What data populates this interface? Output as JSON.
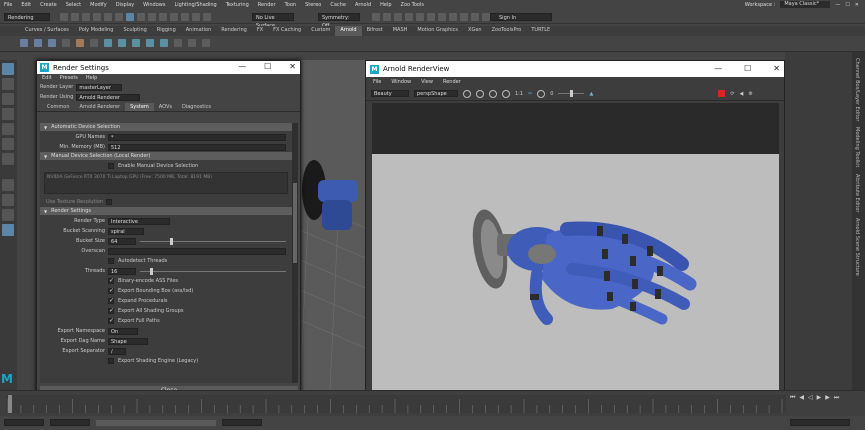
{
  "menubar": [
    "File",
    "Edit",
    "Create",
    "Select",
    "Modify",
    "Display",
    "Windows",
    "Lighting/Shading",
    "Texturing",
    "Render",
    "Toon",
    "Stereo",
    "Cache",
    "Arnold",
    "Help",
    "Zoo Tools"
  ],
  "workspace": {
    "label": "Workspace :",
    "value": "Maya Classic*"
  },
  "statusline": {
    "mode": "Rendering",
    "live_surface": "No Live Surface",
    "symmetry": "Symmetry: Off",
    "sign_in": "Sign In"
  },
  "shelf_tabs": [
    "Curves / Surfaces",
    "Poly Modeling",
    "Sculpting",
    "Rigging",
    "Animation",
    "Rendering",
    "FX",
    "FX Caching",
    "Custom",
    "Arnold",
    "Bifrost",
    "MASH",
    "Motion Graphics",
    "XGen",
    "ZooToolsPro",
    "TURTLE"
  ],
  "shelf_active": "Arnold",
  "right_vtabs": [
    "Channel Box/Layer Editor",
    "Modeling Toolkit",
    "Attribute Editor",
    "Arnold Scene Structure"
  ],
  "render_settings": {
    "title": "Render Settings",
    "menu": [
      "Edit",
      "Presets",
      "Help"
    ],
    "render_layer_label": "Render Layer",
    "render_layer_value": "masterLayer",
    "render_using_label": "Render Using",
    "render_using_value": "Arnold Renderer",
    "tabs": [
      "Common",
      "Arnold Renderer",
      "System",
      "AOVs",
      "Diagnostics"
    ],
    "active_tab": "System",
    "sections": {
      "auto_device": "Automatic Device Selection",
      "gpu_names_label": "GPU Names",
      "gpu_names_value": "*",
      "min_memory_label": "Min. Memory (MB)",
      "min_memory_value": "512",
      "manual_device": "Manual Device Selection (Local Render)",
      "enable_manual": "Enable Manual Device Selection",
      "gpu_list": "NVIDIA GeForce RTX 3070 Ti Laptop GPU (Free: 7500 MB, Total: 8191 MB)",
      "use_texture_res": "Use Texture Resolution",
      "render_settings": "Render Settings",
      "render_type_label": "Render Type",
      "render_type_value": "Interactive",
      "bucket_scanning_label": "Bucket Scanning",
      "bucket_scanning_value": "spiral",
      "bucket_size_label": "Bucket Size",
      "bucket_size_value": "64",
      "overscan_label": "Overscan",
      "autodetect_threads": "Autodetect Threads",
      "threads_label": "Threads",
      "threads_value": "16",
      "checks": [
        "Binary-encode ASS Files",
        "Export Bounding Box (ass/lsd)",
        "Expand Procedurals",
        "Export All Shading Groups",
        "Export Full Paths"
      ],
      "export_namespace_label": "Export Namespace",
      "export_namespace_value": "On",
      "export_dag_label": "Export Dag Name",
      "export_dag_value": "Shape",
      "export_sep_label": "Export Separator",
      "export_sep_value": "/",
      "export_shading": "Export Shading Engine (Legacy)"
    },
    "close_label": "Close"
  },
  "render_view": {
    "title": "Arnold RenderView",
    "menu": [
      "File",
      "Window",
      "View",
      "Render"
    ],
    "display_value": "Beauty",
    "camera_value": "perspShape",
    "ratio": "1:1",
    "exposure_value": "0"
  },
  "timeline_ticks": [
    "1",
    "",
    "",
    "",
    "",
    "",
    "",
    "",
    "",
    "",
    "",
    "",
    "",
    "",
    "",
    "",
    "",
    "",
    "",
    "",
    ""
  ],
  "colors": {
    "maya_bg": "#444444",
    "title_bar": "#ffffff",
    "canvas": "#bdbdbd",
    "hand_blue": "#4a67c8",
    "selected_tool": "#5b86a8",
    "maya_logo": "#1ba6c8"
  }
}
